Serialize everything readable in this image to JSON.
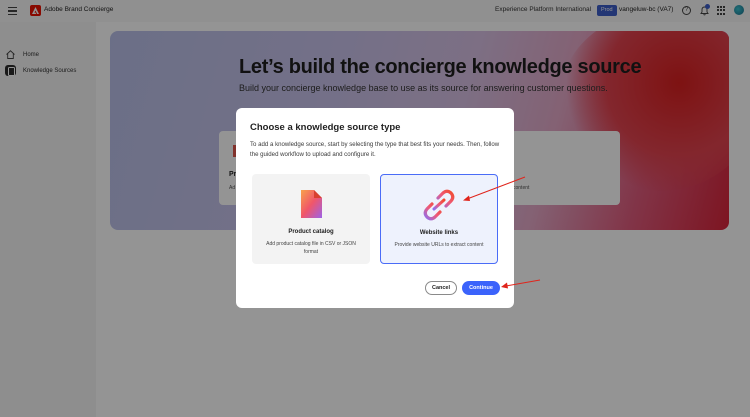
{
  "topbar": {
    "app_title": "Adobe Brand Concierge",
    "org_name": "Experience Platform International",
    "env_badge": "Prod",
    "sandbox_name": "vangeluw-bc (VA7)",
    "help_symbol": "?"
  },
  "sidebar": {
    "items": [
      {
        "label": "Home",
        "icon": "home-icon"
      },
      {
        "label": "Knowledge Sources",
        "icon": "database-icon",
        "selected": true
      }
    ]
  },
  "hero": {
    "title": "Let’s build the concierge knowledge source",
    "subtitle": "Build your concierge knowledge base to use as its source for answering customer questions.",
    "peek_left_title": "Pr",
    "peek_left_desc": "Ad",
    "peek_right_desc": "content"
  },
  "modal": {
    "title": "Choose a knowledge source type",
    "description": "To add a knowledge source, start by selecting the type that best fits your needs. Then, follow the guided workflow to upload and configure it.",
    "options": [
      {
        "label": "Product catalog",
        "description": "Add product catalog file in CSV or JSON format",
        "icon": "document-icon",
        "selected": false
      },
      {
        "label": "Website links",
        "description": "Provide website URLs to extract content",
        "icon": "link-icon",
        "selected": true
      }
    ],
    "cancel_label": "Cancel",
    "continue_label": "Continue"
  },
  "colors": {
    "accent": "#3b63fb",
    "annotation_arrow": "#e0241b",
    "brand": "#eb1000"
  }
}
